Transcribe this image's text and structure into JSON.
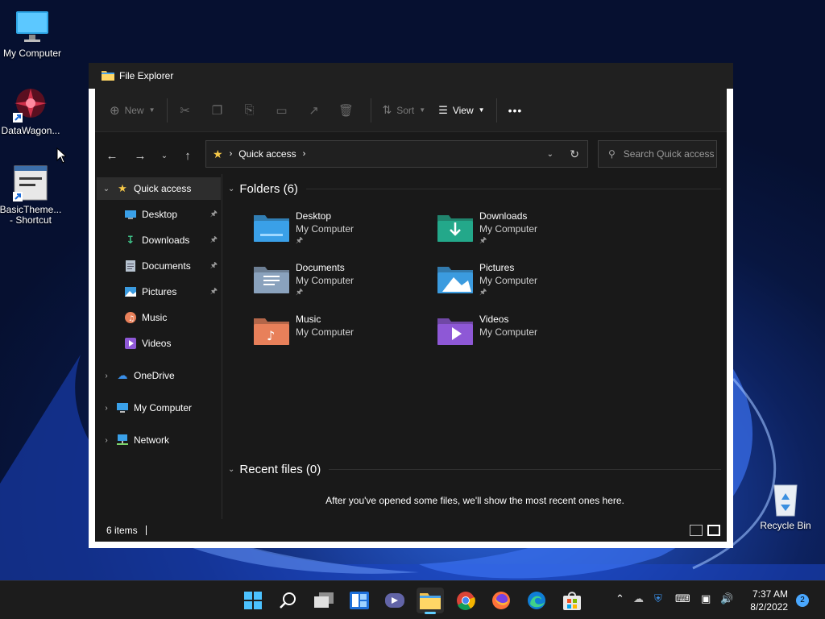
{
  "desktop": {
    "icons": [
      {
        "label": "My Computer"
      },
      {
        "label": "DataWagon..."
      },
      {
        "label": "BasicTheme...\n- Shortcut"
      },
      {
        "label": "Recycle Bin"
      }
    ]
  },
  "window": {
    "title": "File Explorer",
    "toolbar": {
      "new_label": "New",
      "sort_label": "Sort",
      "view_label": "View",
      "more_label": "•••"
    },
    "address": {
      "crumb": "Quick access",
      "search_placeholder": "Search Quick access"
    },
    "sidebar": {
      "items": [
        {
          "label": "Quick access"
        },
        {
          "label": "Desktop"
        },
        {
          "label": "Downloads"
        },
        {
          "label": "Documents"
        },
        {
          "label": "Pictures"
        },
        {
          "label": "Music"
        },
        {
          "label": "Videos"
        },
        {
          "label": "OneDrive"
        },
        {
          "label": "My Computer"
        },
        {
          "label": "Network"
        }
      ]
    },
    "folders_header": "Folders (6)",
    "folders": [
      {
        "name": "Desktop",
        "location": "My Computer",
        "color": "#3aa0e8"
      },
      {
        "name": "Downloads",
        "location": "My Computer",
        "color": "#23a88a"
      },
      {
        "name": "Documents",
        "location": "My Computer",
        "color": "#8aa2bd"
      },
      {
        "name": "Pictures",
        "location": "My Computer",
        "color": "#3b9bdf"
      },
      {
        "name": "Music",
        "location": "My Computer",
        "color": "#e8805a"
      },
      {
        "name": "Videos",
        "location": "My Computer",
        "color": "#8e58d6"
      }
    ],
    "recent_header": "Recent files (0)",
    "recent_empty": "After you've opened some files, we'll show the most recent ones here.",
    "status": "6 items"
  },
  "taskbar": {
    "time": "7:37 AM",
    "date": "8/2/2022",
    "notification_count": "2",
    "accent": "#60cdff"
  }
}
